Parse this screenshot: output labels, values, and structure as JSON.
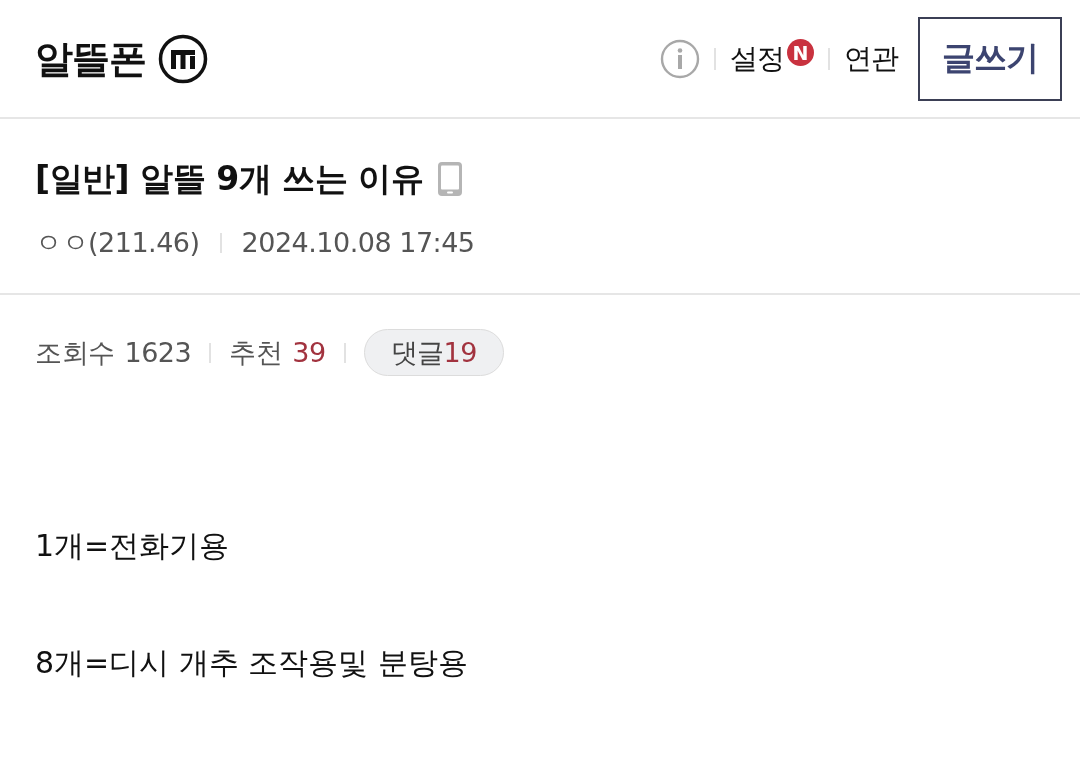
{
  "header": {
    "title": "알뜰폰",
    "links": [
      {
        "label": "설정",
        "badge": "N"
      },
      {
        "label": "연관"
      }
    ],
    "write_button": "글쓰기"
  },
  "post": {
    "title": "[일반] 알뜰 9개 쓰는 이유",
    "author": "ㅇㅇ(211.46)",
    "date": "2024.10.08 17:45"
  },
  "stats": [
    {
      "kind": "text",
      "label": "조회수",
      "value": "1623",
      "accent": false
    },
    {
      "kind": "text",
      "label": "추천",
      "value": "39",
      "accent": true
    },
    {
      "kind": "pill",
      "label": "댓글",
      "value": "19",
      "accent": true
    }
  ],
  "body": [
    "1개=전화기용",
    "8개=디시 개추 조작용및 분탕용"
  ]
}
